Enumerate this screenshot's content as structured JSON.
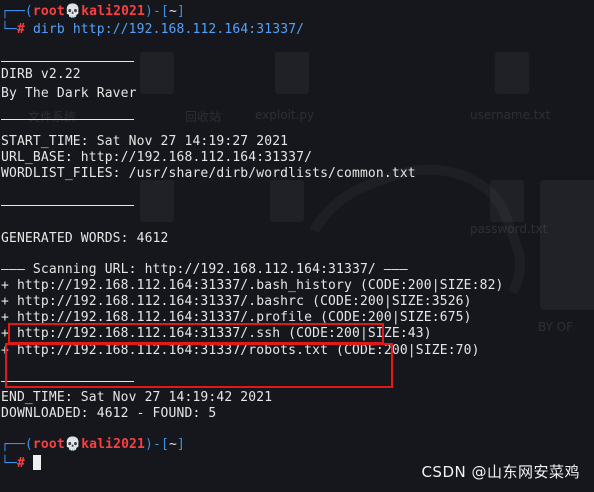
{
  "prompt": {
    "user": "root",
    "skull": "💀",
    "host": "kali2021",
    "cwd": "~",
    "symbol": "#"
  },
  "command": "dirb http://192.168.112.164:31337/",
  "banner": {
    "version": "DIRB v2.22",
    "author": "By The Dark Raver"
  },
  "info": {
    "start_time": "START_TIME: Sat Nov 27 14:19:27 2021",
    "url_base": "URL_BASE: http://192.168.112.164:31337/",
    "wordlist": "WORDLIST_FILES: /usr/share/dirb/wordlists/common.txt"
  },
  "generated_words": "GENERATED WORDS: 4612",
  "scanning": "——— Scanning URL: http://192.168.112.164:31337/ ———",
  "results": [
    "+ http://192.168.112.164:31337/.bash_history (CODE:200|SIZE:82)",
    "+ http://192.168.112.164:31337/.bashrc (CODE:200|SIZE:3526)",
    "+ http://192.168.112.164:31337/.profile (CODE:200|SIZE:675)",
    "+ http://192.168.112.164:31337/.ssh (CODE:200|SIZE:43)",
    "+ http://192.168.112.164:31337/robots.txt (CODE:200|SIZE:70)"
  ],
  "summary": {
    "end_time": "END_TIME: Sat Nov 27 14:19:42 2021",
    "downloaded": "DOWNLOADED: 4612 - FOUND: 5"
  },
  "watermark": "CSDN @山东网安菜鸡",
  "background_labels": [
    "username.txt",
    "password.txt",
    "exploit.py",
    "回收站",
    "文件系统",
    "BY OF"
  ],
  "colors": {
    "background": "#15171d",
    "prompt_blue": "#3b8eea",
    "prompt_red": "#ff3d3d",
    "highlight_red": "#e01919"
  }
}
